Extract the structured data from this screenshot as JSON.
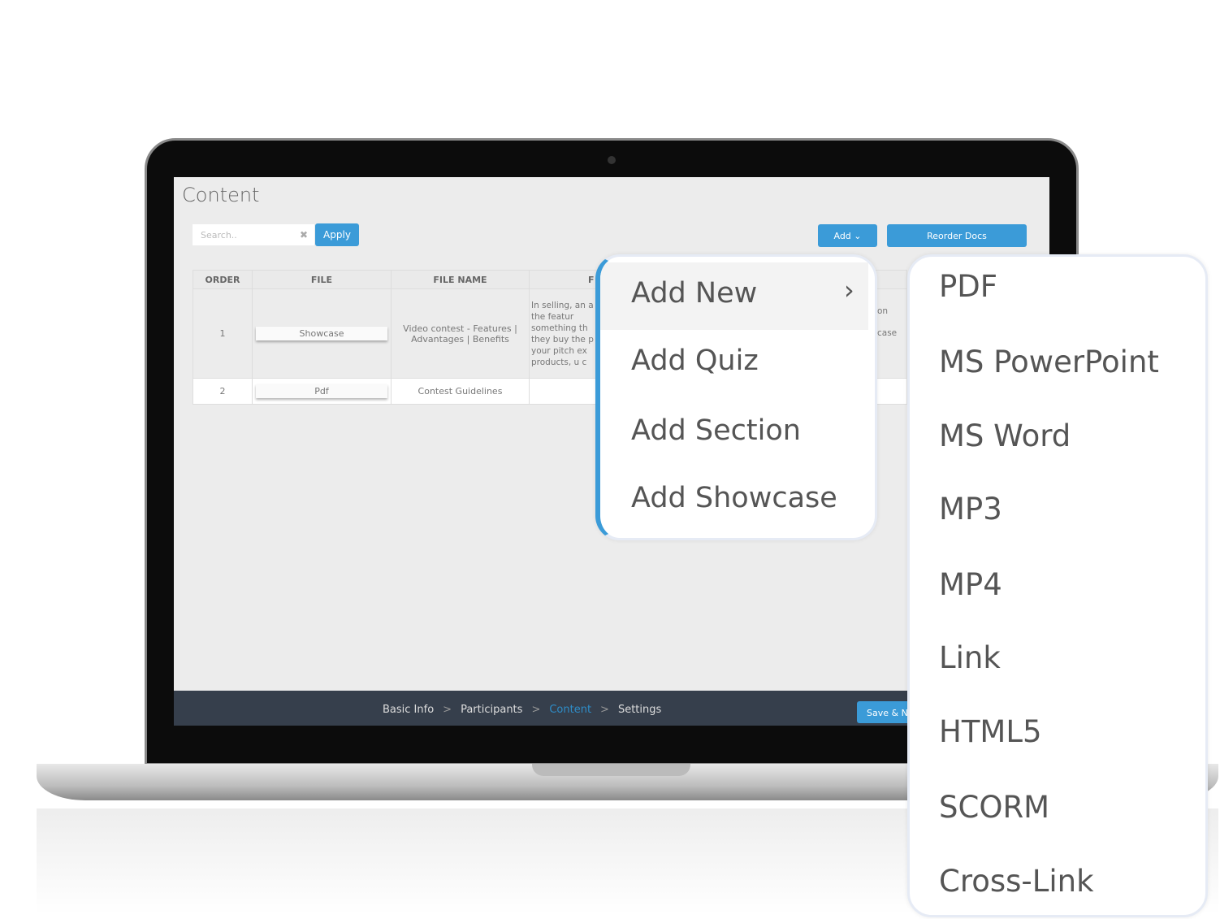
{
  "page": {
    "title": "Content"
  },
  "search": {
    "placeholder": "Search..",
    "clear_icon": "close-icon",
    "apply_label": "Apply"
  },
  "toolbar": {
    "add_label": "Add ⌄",
    "reorder_label": "Reorder Docs"
  },
  "table": {
    "headers": [
      "ORDER",
      "FILE",
      "FILE NAME",
      "F"
    ],
    "rows": [
      {
        "order": "1",
        "file": "Showcase",
        "file_name": "Video contest - Features | Advantages | Benefits",
        "description": "In selling, an a the featur something th they buy the p your pitch ex products, u c",
        "extra1": "on",
        "extra2": "case"
      },
      {
        "order": "2",
        "file": "Pdf",
        "file_name": "Contest Guidelines",
        "description": ""
      }
    ]
  },
  "footer": {
    "steps": [
      "Basic Info",
      "Participants",
      "Content",
      "Settings"
    ],
    "separator": ">",
    "active": "Content",
    "save_label": "Save & N"
  },
  "add_menu": {
    "items": [
      {
        "label": "Add New",
        "submenu_icon": "chevron-right-icon"
      },
      {
        "label": "Add Quiz"
      },
      {
        "label": "Add Section"
      },
      {
        "label": "Add Showcase"
      }
    ]
  },
  "add_new_submenu": {
    "items": [
      "PDF",
      "MS PowerPoint",
      "MS Word",
      "MP3",
      "MP4",
      "Link",
      "HTML5",
      "SCORM",
      "Cross-Link"
    ]
  },
  "colors": {
    "accent": "#3b9bd8",
    "footer": "#363f4c",
    "screen": "#ececec"
  }
}
